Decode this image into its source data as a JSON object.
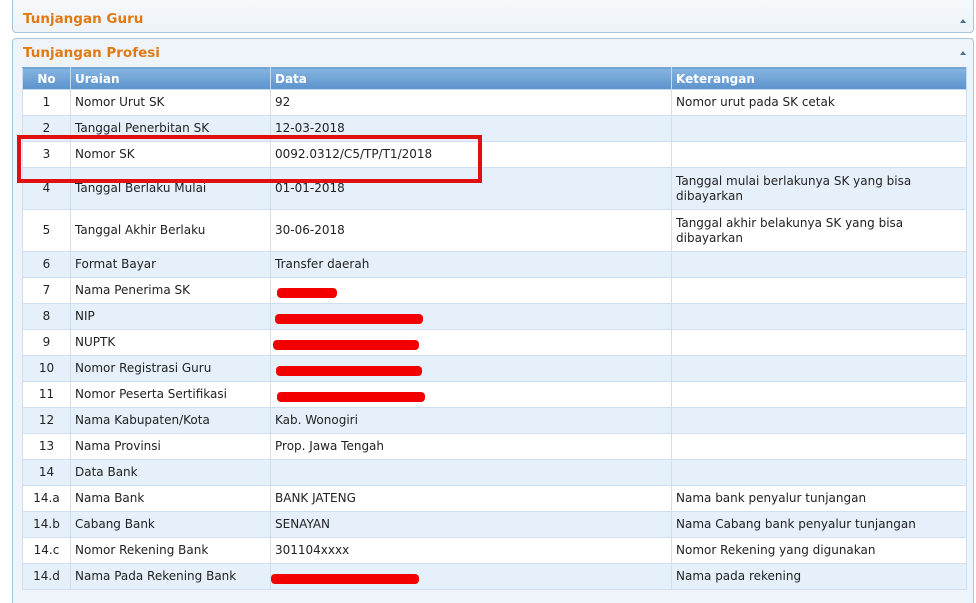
{
  "panels": {
    "guru_title": "Tunjangan Guru",
    "profesi_title": "Tunjangan Profesi"
  },
  "table": {
    "headers": {
      "no": "No",
      "uraian": "Uraian",
      "data": "Data",
      "keterangan": "Keterangan"
    },
    "rows": [
      {
        "no": "1",
        "uraian": "Nomor Urut SK",
        "data": "92",
        "keterangan": "Nomor urut pada SK cetak"
      },
      {
        "no": "2",
        "uraian": "Tanggal Penerbitan SK",
        "data": "12-03-2018",
        "keterangan": ""
      },
      {
        "no": "3",
        "uraian": "Nomor SK",
        "data": "0092.0312/C5/TP/T1/2018",
        "keterangan": ""
      },
      {
        "no": "4",
        "uraian": "Tanggal Berlaku Mulai",
        "data": "01-01-2018",
        "keterangan": "Tanggal mulai berlakunya SK yang bisa dibayarkan"
      },
      {
        "no": "5",
        "uraian": "Tanggal Akhir Berlaku",
        "data": "30-06-2018",
        "keterangan": "Tanggal akhir belakunya SK yang bisa dibayarkan"
      },
      {
        "no": "6",
        "uraian": "Format Bayar",
        "data": "Transfer daerah",
        "keterangan": ""
      },
      {
        "no": "7",
        "uraian": "Nama Penerima SK",
        "data": "",
        "keterangan": ""
      },
      {
        "no": "8",
        "uraian": "NIP",
        "data": "",
        "keterangan": ""
      },
      {
        "no": "9",
        "uraian": "NUPTK",
        "data": "",
        "keterangan": ""
      },
      {
        "no": "10",
        "uraian": "Nomor Registrasi Guru",
        "data": "",
        "keterangan": ""
      },
      {
        "no": "11",
        "uraian": "Nomor Peserta Sertifikasi",
        "data": "",
        "keterangan": ""
      },
      {
        "no": "12",
        "uraian": "Nama Kabupaten/Kota",
        "data": "Kab. Wonogiri",
        "keterangan": ""
      },
      {
        "no": "13",
        "uraian": "Nama Provinsi",
        "data": "Prop. Jawa Tengah",
        "keterangan": ""
      },
      {
        "no": "14",
        "uraian": "Data Bank",
        "data": "",
        "keterangan": ""
      },
      {
        "no": "14.a",
        "uraian": "Nama Bank",
        "data": "BANK JATENG",
        "keterangan": "Nama bank penyalur tunjangan"
      },
      {
        "no": "14.b",
        "uraian": "Cabang Bank",
        "data": "SENAYAN",
        "keterangan": "Nama Cabang bank penyalur tunjangan"
      },
      {
        "no": "14.c",
        "uraian": "Nomor Rekening Bank",
        "data": "301104xxxx",
        "keterangan": "Nomor Rekening yang digunakan"
      },
      {
        "no": "14.d",
        "uraian": "Nama Pada Rekening Bank",
        "data": "",
        "keterangan": "Nama pada rekening"
      }
    ]
  },
  "colors": {
    "title_orange": "#e27a12",
    "header_blue": "#5b93cc",
    "row_alt": "#e6f0fa",
    "highlight_red": "#e01010",
    "redaction_red": "#f20000"
  },
  "icons": {
    "collapse": "chevron-up-icon"
  }
}
